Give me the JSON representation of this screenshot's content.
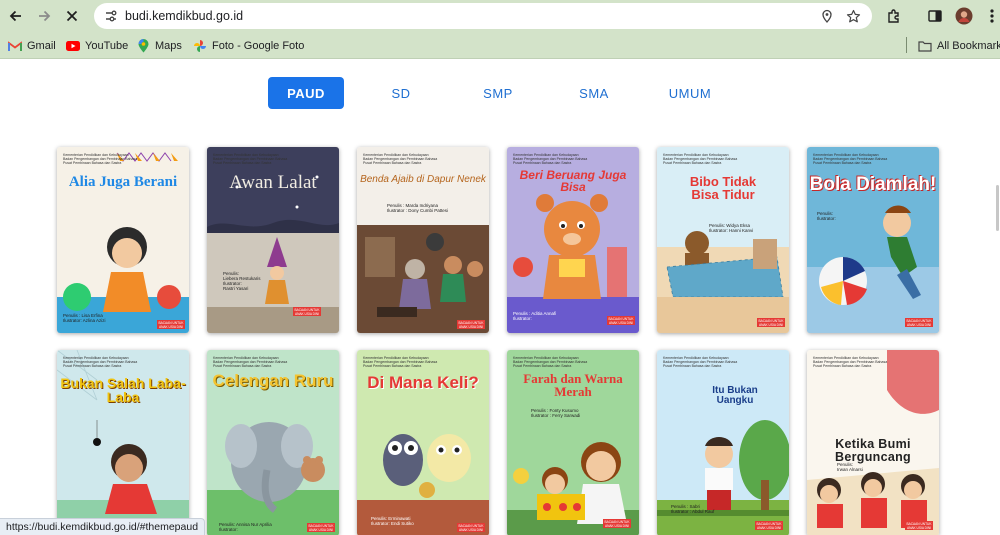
{
  "browser": {
    "url": "budi.kemdikbud.go.id",
    "status_url": "https://budi.kemdikbud.go.id/#themepaud",
    "bookmarks": [
      {
        "label": "Gmail",
        "icon": "gmail-icon"
      },
      {
        "label": "YouTube",
        "icon": "youtube-icon"
      },
      {
        "label": "Maps",
        "icon": "maps-icon"
      },
      {
        "label": "Foto - Google Foto",
        "icon": "google-photos-icon"
      }
    ],
    "all_bookmarks": "All Bookmarks"
  },
  "tabs": [
    {
      "label": "PAUD",
      "active": true
    },
    {
      "label": "SD",
      "active": false
    },
    {
      "label": "SMP",
      "active": false
    },
    {
      "label": "SMA",
      "active": false
    },
    {
      "label": "UMUM",
      "active": false
    }
  ],
  "books": [
    {
      "title": "Alia Juga Berani",
      "credit": "Penulis : Lisa Erfina\nIlustrator: Azlina Azizi"
    },
    {
      "title": "Awan Lalat",
      "credit": "Penulis:\nLiebera Restukaris\nIlustrator:\nRastri Yasari"
    },
    {
      "title": "Benda Ajaib di Dapur Nenek",
      "credit": "Penulis : Marda Indriyana\nIlustrator : Dony Cumbi Pattesi"
    },
    {
      "title": "Beri Beruang Juga Bisa",
      "credit": "Penulis : Aditia Annafi\nIlustrator:"
    },
    {
      "title": "Bibo Tidak Bisa Tidur",
      "credit": "Penulis: Widya Eksa\nIlustrator: Hanni Kanvi"
    },
    {
      "title": "Bola Diamlah!",
      "credit": "Penulis:\nIlustrator:"
    },
    {
      "title": "Bukan Salah Laba-Laba",
      "credit": "Penulis: Tsamut Nisa Wardhani\nIlustrator: Ardhian Nugraha"
    },
    {
      "title": "Celengan Ruru",
      "credit": "Penulis: Annisa Nur Aprilia\nIlustrator:"
    },
    {
      "title": "Di Mana Keli?",
      "credit": "Penulis: Erminawati\nIlustrator: Endi Sutiko"
    },
    {
      "title": "Farah dan Warna Merah",
      "credit": "Penulis : Fonty Kusumo\nIlustrator : Ferry Sarwadi"
    },
    {
      "title": "Itu Bukan Uangku",
      "credit": "Penulis : Sabri\nIlustrator : Abdul Rauf"
    },
    {
      "title": "Ketika Bumi Berguncang",
      "credit": "Penulis:\nIrwan Alnarsi"
    }
  ],
  "book_common": {
    "publisher": "Kementerian Pendidikan dan Kebudayaan\nBadan Pengembangan dan Pembinaan Bahasa\nPusat Pembinaan Bahasa dan Sastra",
    "badge": "BACAAN UNTUK ANAK USIA DINI"
  },
  "colors": {
    "accent": "#1a73e8",
    "chrome": "#d3e3c9"
  }
}
